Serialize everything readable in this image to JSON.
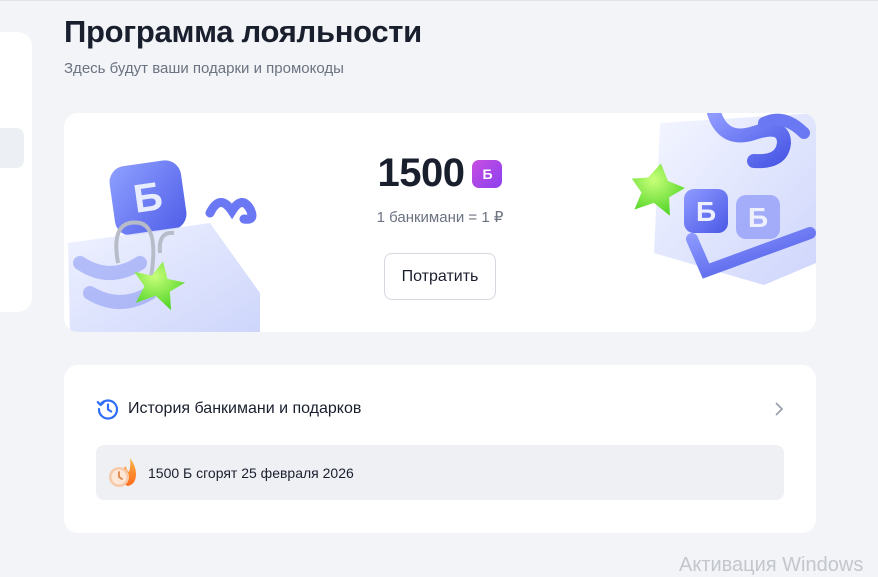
{
  "page": {
    "title": "Программа лояльности",
    "subtitle": "Здесь будут ваши подарки и промокоды"
  },
  "balance": {
    "amount": "1500",
    "currency_badge": "Б",
    "rate": "1 банкимани = 1 ₽",
    "spend_button": "Потратить",
    "illustrations": [
      "shopping-bag-illustration",
      "gift-box-illustration",
      "green-star-icon"
    ]
  },
  "history": {
    "label": "История банкимани и подарков",
    "icon": "history-clock-icon",
    "chevron": "chevron-right-icon",
    "expiry_text": "1500 Б сгорят 25 февраля 2026",
    "expiry_icon": "burning-clock-icon"
  },
  "watermark": {
    "text": "Активация Windows"
  },
  "colors": {
    "background": "#f2f4f8",
    "card": "#ffffff",
    "text_primary": "#1a1f2e",
    "text_secondary": "#6b7280",
    "badge_gradient_start": "#c84fe0",
    "badge_gradient_end": "#8b3ff0",
    "accent_blue": "#2f6df6",
    "star_green": "#7bea3a"
  }
}
